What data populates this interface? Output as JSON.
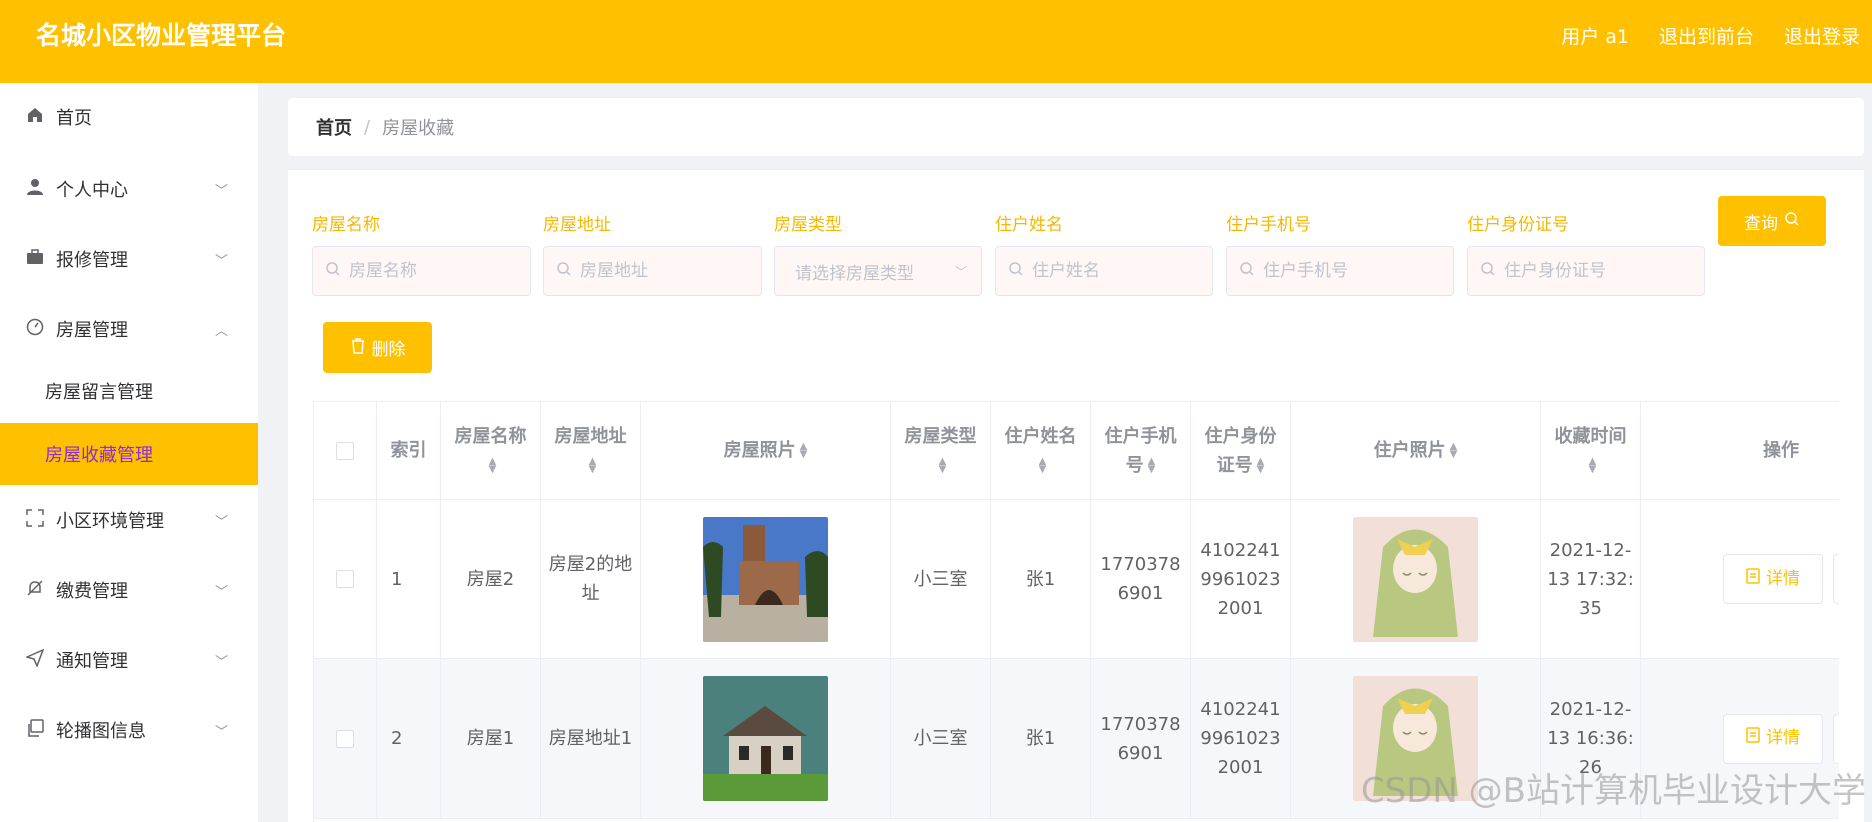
{
  "header": {
    "title": "名城小区物业管理平台",
    "user_label": "用户 a1",
    "front_link": "退出到前台",
    "logout_link": "退出登录"
  },
  "sidebar": {
    "items": [
      {
        "label": "首页",
        "icon": "home-icon"
      },
      {
        "label": "个人中心",
        "icon": "user-icon"
      },
      {
        "label": "报修管理",
        "icon": "briefcase-icon"
      },
      {
        "label": "房屋管理",
        "icon": "dashboard-icon"
      },
      {
        "label": "小区环境管理",
        "icon": "fullscreen-icon"
      },
      {
        "label": "缴费管理",
        "icon": "bell-off-icon"
      },
      {
        "label": "通知管理",
        "icon": "send-icon"
      },
      {
        "label": "轮播图信息",
        "icon": "copy-icon"
      }
    ],
    "subitems": [
      {
        "label": "房屋留言管理"
      },
      {
        "label": "房屋收藏管理",
        "active": true
      }
    ]
  },
  "breadcrumb": {
    "home": "首页",
    "current": "房屋收藏"
  },
  "filters": {
    "house_name": {
      "label": "房屋名称",
      "placeholder": "房屋名称"
    },
    "house_address": {
      "label": "房屋地址",
      "placeholder": "房屋地址"
    },
    "house_type": {
      "label": "房屋类型",
      "placeholder": "请选择房屋类型"
    },
    "resident_name": {
      "label": "住户姓名",
      "placeholder": "住户姓名"
    },
    "resident_phone": {
      "label": "住户手机号",
      "placeholder": "住户手机号"
    },
    "resident_id": {
      "label": "住户身份证号",
      "placeholder": "住户身份证号"
    }
  },
  "buttons": {
    "query": "查询",
    "delete": "删除",
    "detail": "详情"
  },
  "table": {
    "headers": {
      "index": "索引",
      "house_name": "房屋名称",
      "house_address": "房屋地址",
      "house_photo": "房屋照片",
      "house_type": "房屋类型",
      "resident_name": "住户姓名",
      "resident_phone": "住户手机号",
      "resident_id": "住户身份证号",
      "resident_photo": "住户照片",
      "favorite_time": "收藏时间",
      "actions": "操作"
    },
    "rows": [
      {
        "index": "1",
        "house_name": "房屋2",
        "house_address": "房屋2的地址",
        "house_type": "小三室",
        "resident_name": "张1",
        "resident_phone": "17703786901",
        "resident_id": "410224199610232001",
        "favorite_time": "2021-12-13 17:32:35"
      },
      {
        "index": "2",
        "house_name": "房屋1",
        "house_address": "房屋地址1",
        "house_type": "小三室",
        "resident_name": "张1",
        "resident_phone": "17703786901",
        "resident_id": "410224199610232001",
        "favorite_time": "2021-12-13 16:36:26"
      }
    ]
  },
  "colors": {
    "accent": "#FFC000",
    "active_text": "#8e2bd6",
    "label_text": "#F5B800"
  },
  "watermark": "CSDN @B站计算机毕业设计大学"
}
